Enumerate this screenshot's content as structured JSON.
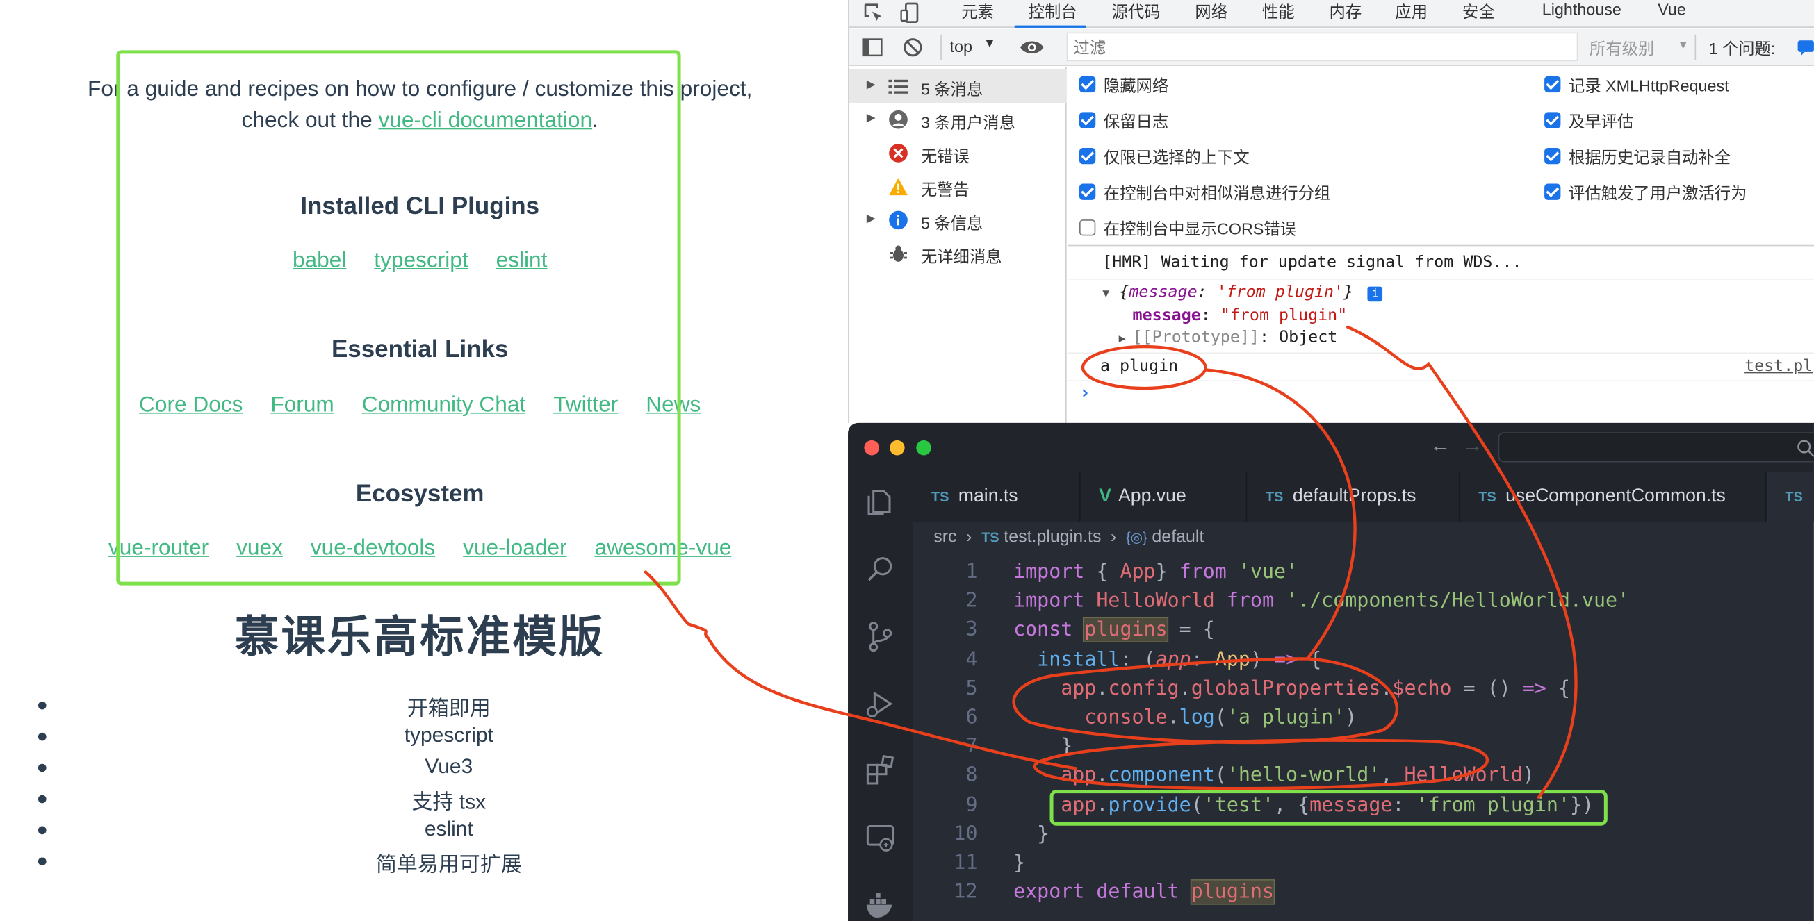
{
  "vue_page": {
    "intro_line1": "For a guide and recipes on how to configure / customize this project,",
    "intro_prefix": "check out the ",
    "intro_link": "vue-cli documentation",
    "intro_suffix": ".",
    "plugins_heading": "Installed CLI Plugins",
    "plugins": [
      "babel",
      "typescript",
      "eslint"
    ],
    "links_heading": "Essential Links",
    "links": [
      "Core Docs",
      "Forum",
      "Community Chat",
      "Twitter",
      "News"
    ],
    "ecosystem_heading": "Ecosystem",
    "ecosystem": [
      "vue-router",
      "vuex",
      "vue-devtools",
      "vue-loader",
      "awesome-vue"
    ],
    "main_title": "慕课乐高标准模版",
    "features": [
      "开箱即用",
      "typescript",
      "Vue3",
      "支持 tsx",
      "eslint",
      "简单易用可扩展"
    ]
  },
  "devtools": {
    "tabs": [
      "元素",
      "控制台",
      "源代码",
      "网络",
      "性能",
      "内存",
      "应用",
      "安全",
      "Lighthouse",
      "Vue"
    ],
    "active_tab": "控制台",
    "context": "top",
    "filter_placeholder": "过滤",
    "levels": "所有级别",
    "issues": "1 个问题:",
    "sidebar": [
      "5 条消息",
      "3 条用户消息",
      "无错误",
      "无警告",
      "5 条信息",
      "无详细消息"
    ],
    "settings_left": [
      "隐藏网络",
      "保留日志",
      "仅限已选择的上下文",
      "在控制台中对相似消息进行分组",
      "在控制台中显示CORS错误"
    ],
    "settings_right": [
      "记录 XMLHttpRequest",
      "及早评估",
      "根据历史记录自动补全",
      "评估触发了用户激活行为"
    ],
    "console": {
      "hmr": "[HMR] Waiting for update signal from WDS...",
      "obj_open": "{",
      "obj_key": "message",
      "obj_sep": ": ",
      "obj_val": "'from plugin'",
      "obj_close": "}",
      "prop_key": "message",
      "prop_val": "\"from plugin\"",
      "proto": "[[Prototype]]",
      "proto_val": "Object",
      "log": "a plugin",
      "source": "test.pl",
      "prompt": "›"
    }
  },
  "vscode": {
    "tabs": [
      "main.ts",
      "App.vue",
      "defaultProps.ts",
      "useComponentCommon.ts",
      "TS"
    ],
    "ts_badge": "TS",
    "breadcrumb": [
      "src",
      "test.plugin.ts",
      "default"
    ],
    "line_numbers": [
      "1",
      "2",
      "3",
      "4",
      "5",
      "6",
      "7",
      "8",
      "9",
      "10",
      "11",
      "12"
    ],
    "code": [
      [
        [
          "k",
          "import"
        ],
        [
          "t",
          " { "
        ],
        [
          "v",
          "App"
        ],
        [
          "t",
          "} "
        ],
        [
          "k",
          "from"
        ],
        [
          "t",
          " "
        ],
        [
          "s",
          "'vue'"
        ]
      ],
      [
        [
          "k",
          "import"
        ],
        [
          "t",
          " "
        ],
        [
          "v",
          "HelloWorld"
        ],
        [
          "t",
          " "
        ],
        [
          "k",
          "from"
        ],
        [
          "t",
          " "
        ],
        [
          "s",
          "'./components/HelloWorld.vue'"
        ]
      ],
      [
        [
          "k",
          "const"
        ],
        [
          "t",
          " "
        ],
        [
          "h",
          "plugins"
        ],
        [
          "t",
          " = {"
        ]
      ],
      [
        [
          "t",
          "  "
        ],
        [
          "f",
          "install"
        ],
        [
          "t",
          ": ("
        ],
        [
          "i",
          "app"
        ],
        [
          "t",
          ": "
        ],
        [
          "p",
          "App"
        ],
        [
          "t",
          ") "
        ],
        [
          "k",
          "=>"
        ],
        [
          "t",
          " {"
        ]
      ],
      [
        [
          "t",
          "    "
        ],
        [
          "v",
          "app"
        ],
        [
          "t",
          "."
        ],
        [
          "v",
          "config"
        ],
        [
          "t",
          "."
        ],
        [
          "v",
          "globalProperties"
        ],
        [
          "t",
          "."
        ],
        [
          "v",
          "$echo"
        ],
        [
          "t",
          " = () "
        ],
        [
          "k",
          "=>"
        ],
        [
          "t",
          " {"
        ]
      ],
      [
        [
          "t",
          "      "
        ],
        [
          "v",
          "console"
        ],
        [
          "t",
          "."
        ],
        [
          "f",
          "log"
        ],
        [
          "t",
          "("
        ],
        [
          "s",
          "'a plugin'"
        ],
        [
          "t",
          ")"
        ]
      ],
      [
        [
          "t",
          "    }"
        ]
      ],
      [
        [
          "t",
          "    "
        ],
        [
          "v",
          "app"
        ],
        [
          "t",
          "."
        ],
        [
          "f",
          "component"
        ],
        [
          "t",
          "("
        ],
        [
          "s",
          "'hello-world'"
        ],
        [
          "t",
          ", "
        ],
        [
          "v",
          "HelloWorld"
        ],
        [
          "t",
          ")"
        ]
      ],
      [
        [
          "t",
          "    "
        ],
        [
          "v",
          "app"
        ],
        [
          "t",
          "."
        ],
        [
          "f",
          "provide"
        ],
        [
          "t",
          "("
        ],
        [
          "s",
          "'test'"
        ],
        [
          "t",
          ", {"
        ],
        [
          "v",
          "message"
        ],
        [
          "t",
          ": "
        ],
        [
          "s",
          "'from plugin'"
        ],
        [
          "t",
          "})"
        ]
      ],
      [
        [
          "t",
          "  }"
        ]
      ],
      [
        [
          "t",
          "}"
        ]
      ],
      [
        [
          "k",
          "export"
        ],
        [
          "t",
          " "
        ],
        [
          "k",
          "default"
        ],
        [
          "t",
          " "
        ],
        [
          "h",
          "plugins"
        ]
      ]
    ]
  },
  "colors": {
    "vue_green": "#42b983",
    "annotation_red": "#e8401c",
    "annotation_green": "#7ee04a",
    "editor_bg": "#282c34"
  }
}
